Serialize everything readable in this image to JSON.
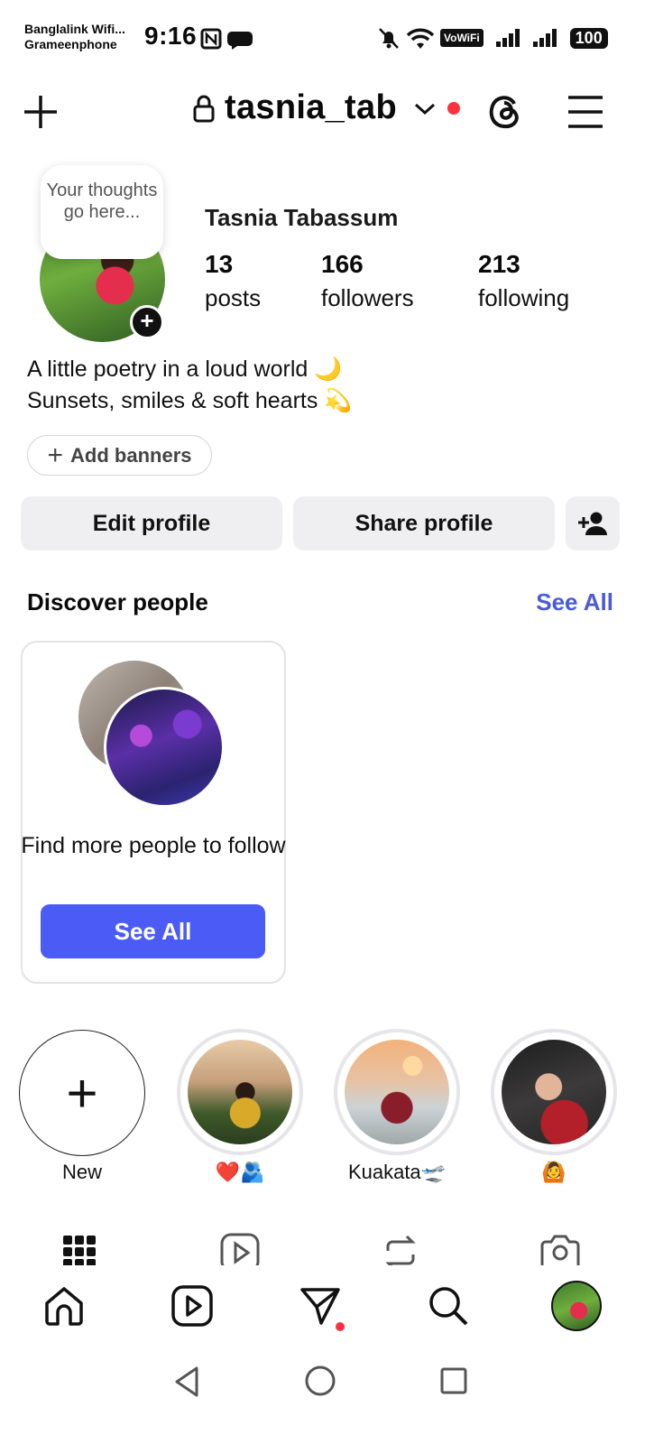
{
  "status_bar": {
    "carrier_line1": "Banglalink Wifi...",
    "carrier_line2": "Grameenphone",
    "time": "9:16",
    "vowifi": "VoWiFi",
    "battery": "100"
  },
  "header": {
    "username": "tasnia_tab"
  },
  "profile": {
    "note": "Your thoughts go here...",
    "full_name": "Tasnia Tabassum",
    "stats": [
      {
        "value": "13",
        "label": "posts"
      },
      {
        "value": "166",
        "label": "followers"
      },
      {
        "value": "213",
        "label": "following"
      }
    ],
    "bio_line1": "A little poetry in a loud world 🌙",
    "bio_line2": "Sunsets, smiles & soft hearts 💫",
    "add_banners_label": "Add banners"
  },
  "actions": {
    "edit_profile": "Edit profile",
    "share_profile": "Share profile"
  },
  "discover": {
    "title": "Discover people",
    "see_all_link": "See All",
    "card_text": "Find more people to follow",
    "card_button": "See All"
  },
  "highlights": [
    {
      "label": "New"
    },
    {
      "label": "❤️🫂"
    },
    {
      "label": "Kuakata🛫"
    },
    {
      "label": "🙆"
    }
  ],
  "colors": {
    "accent_blue": "#4a5cf5",
    "link_blue": "#4a5bd8",
    "notification_red": "#ff3040",
    "button_gray": "#efeff2"
  }
}
